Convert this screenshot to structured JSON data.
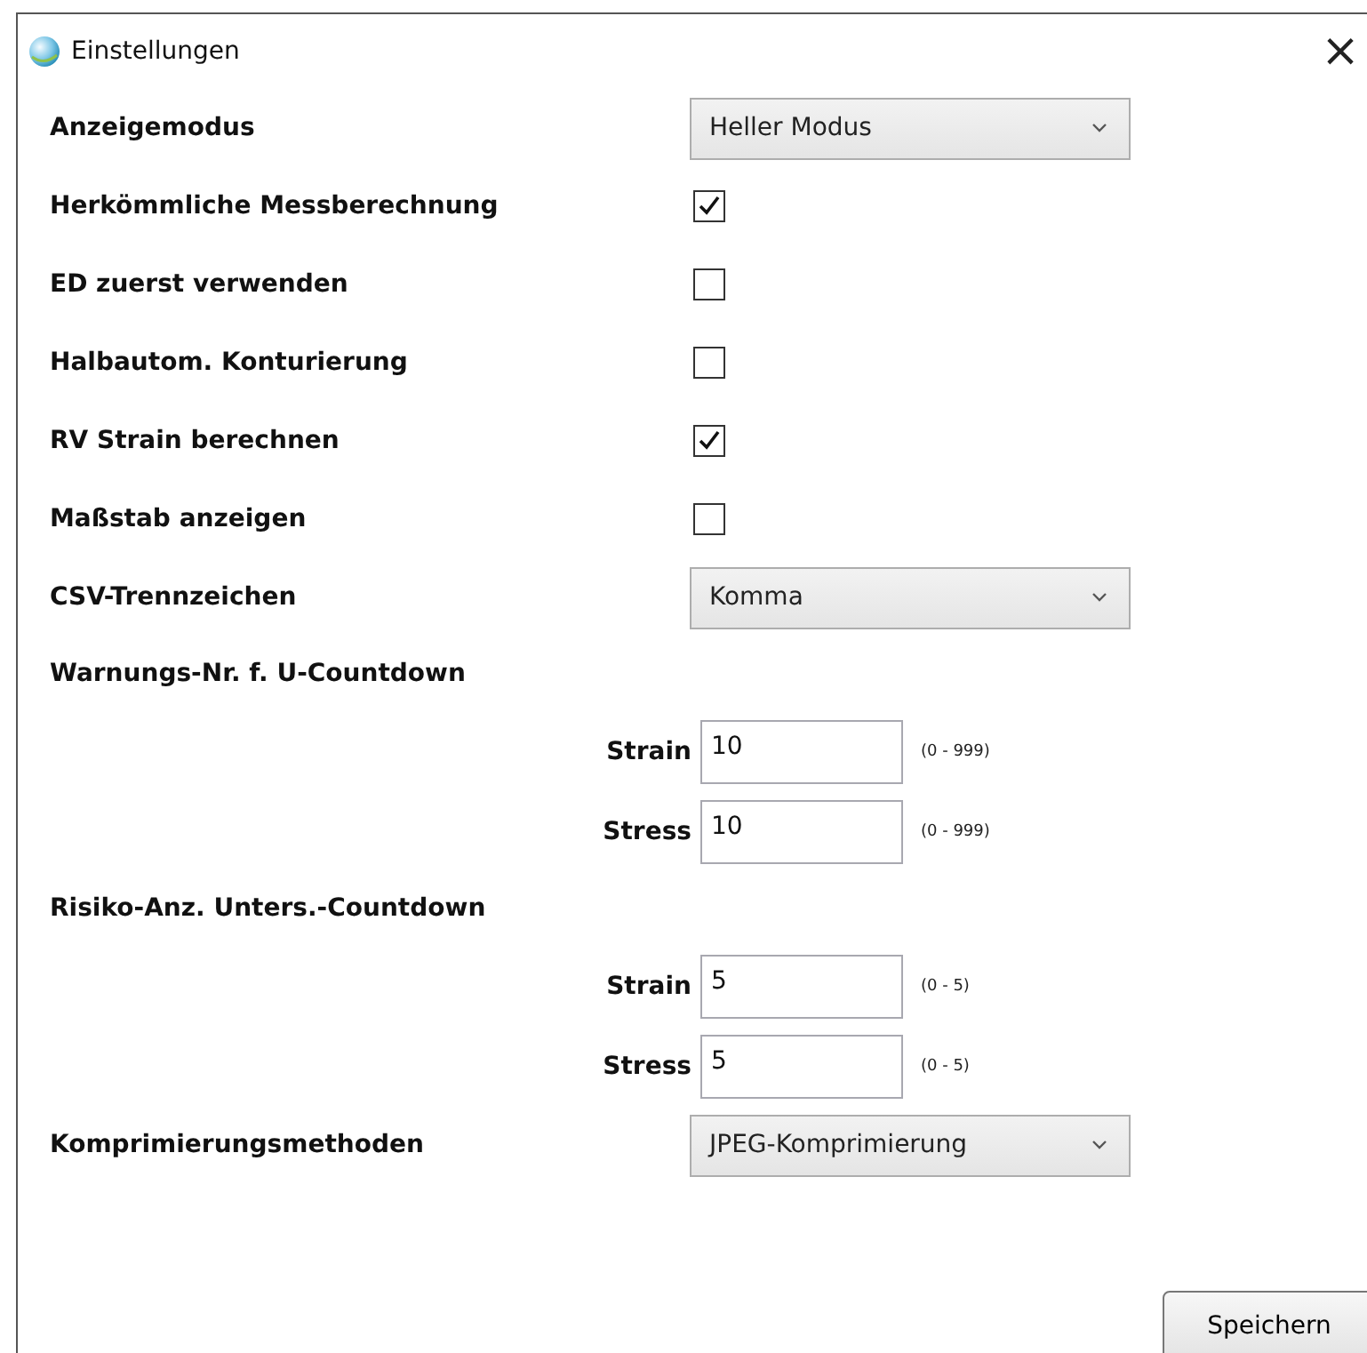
{
  "window": {
    "title": "Einstellungen",
    "close": "×"
  },
  "settings": [
    {
      "kind": "select",
      "label": "Anzeigemodus",
      "value": "Heller Modus"
    },
    {
      "kind": "checkbox",
      "label": "Herkömmliche Messberechnung",
      "checked": true
    },
    {
      "kind": "checkbox",
      "label": "ED zuerst verwenden",
      "checked": false
    },
    {
      "kind": "checkbox",
      "label": "Halbautom. Konturierung",
      "checked": false
    },
    {
      "kind": "checkbox",
      "label": "RV Strain berechnen",
      "checked": true
    },
    {
      "kind": "checkbox",
      "label": "Maßstab anzeigen",
      "checked": false
    },
    {
      "kind": "select",
      "label": "CSV-Trennzeichen",
      "value": "Komma"
    },
    {
      "kind": "group",
      "label": "Warnungs-Nr. f. U-Countdown",
      "fields": [
        {
          "label": "Strain",
          "value": "10",
          "range": "(0 - 999)"
        },
        {
          "label": "Stress",
          "value": "10",
          "range": "(0 - 999)"
        }
      ]
    },
    {
      "kind": "group",
      "label": "Risiko-Anz. Unters.-Countdown",
      "fields": [
        {
          "label": "Strain",
          "value": "5",
          "range": "(0 - 5)"
        },
        {
          "label": "Stress",
          "value": "5",
          "range": "(0 - 5)"
        }
      ]
    },
    {
      "kind": "select",
      "label": "Komprimierungsmethoden",
      "value": "JPEG-Komprimierung"
    }
  ],
  "buttons": [
    "Speichern"
  ]
}
